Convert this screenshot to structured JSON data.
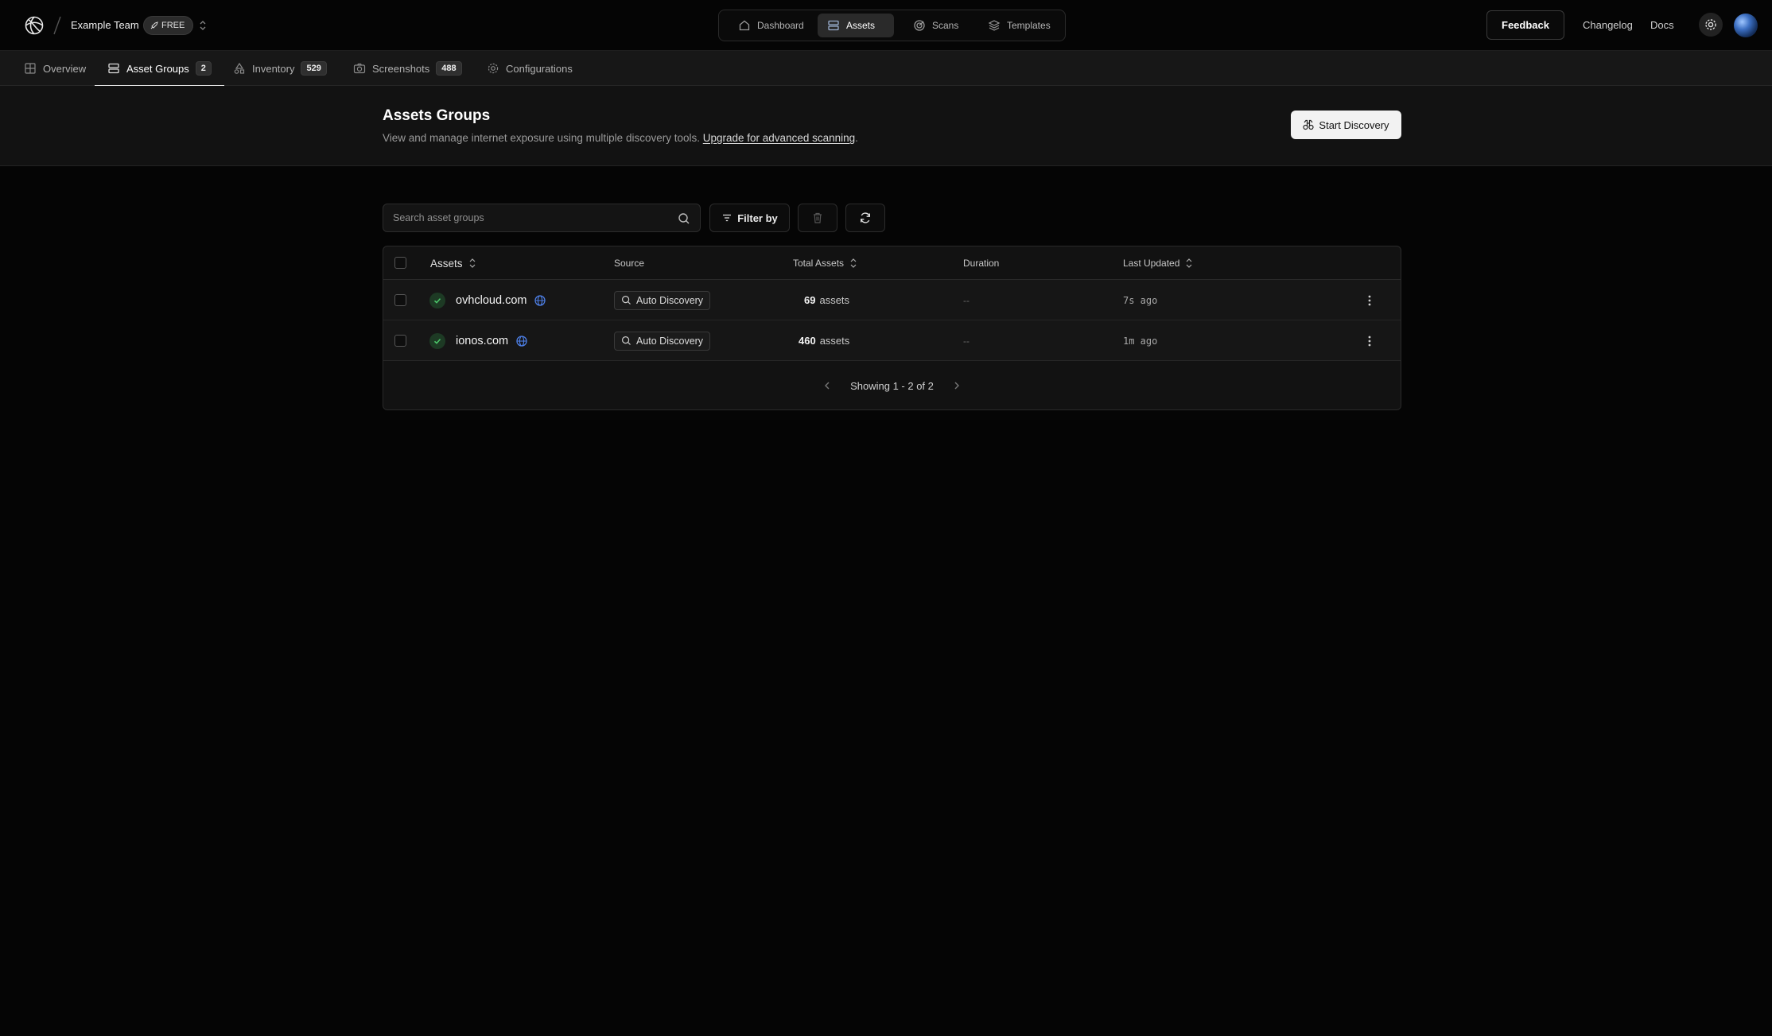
{
  "header": {
    "team_name": "Example Team",
    "plan_badge": "FREE",
    "nav": [
      {
        "label": "Dashboard",
        "icon": "home-icon"
      },
      {
        "label": "Assets",
        "icon": "server-icon",
        "active": true
      },
      {
        "label": "Scans",
        "icon": "target-icon"
      },
      {
        "label": "Templates",
        "icon": "layers-icon"
      }
    ],
    "feedback_label": "Feedback",
    "changelog_label": "Changelog",
    "docs_label": "Docs"
  },
  "subnav": [
    {
      "label": "Overview",
      "icon": "overview-icon"
    },
    {
      "label": "Asset Groups",
      "count": "2",
      "icon": "server-icon",
      "active": true
    },
    {
      "label": "Inventory",
      "count": "529",
      "icon": "shapes-icon"
    },
    {
      "label": "Screenshots",
      "count": "488",
      "icon": "camera-icon"
    },
    {
      "label": "Configurations",
      "icon": "gear-icon"
    }
  ],
  "page": {
    "title": "Assets Groups",
    "subtitle": "View and manage internet exposure using multiple discovery tools.",
    "upgrade_link": "Upgrade for advanced scanning",
    "subtitle_end": ".",
    "start_button": "Start Discovery"
  },
  "toolbar": {
    "search_placeholder": "Search asset groups",
    "filter_label": "Filter by"
  },
  "table": {
    "columns": [
      "Assets",
      "Source",
      "Total Assets",
      "Duration",
      "Last Updated"
    ],
    "rows": [
      {
        "domain": "ovhcloud.com",
        "source": "Auto Discovery",
        "total": "69",
        "unit": "assets",
        "duration": "--",
        "updated": "7s ago"
      },
      {
        "domain": "ionos.com",
        "source": "Auto Discovery",
        "total": "460",
        "unit": "assets",
        "duration": "--",
        "updated": "1m ago"
      }
    ],
    "pagination": "Showing 1 - 2 of 2"
  },
  "colors": {
    "background": "#050505",
    "accent_green": "#4cc66a",
    "globe_blue": "#4d7fe6"
  }
}
